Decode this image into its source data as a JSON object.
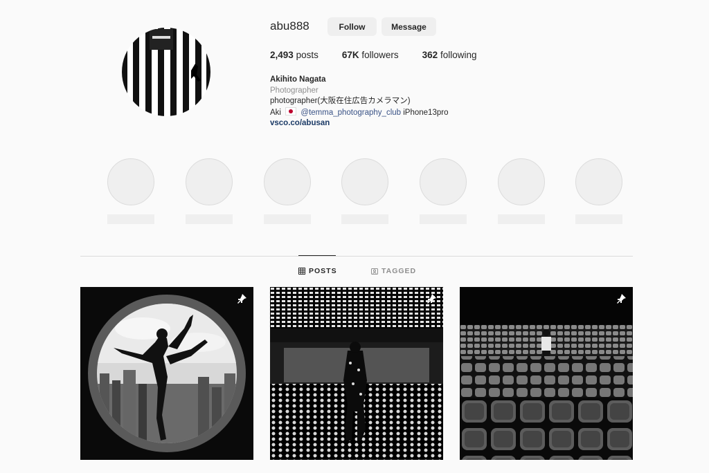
{
  "profile": {
    "username": "abu888",
    "follow_label": "Follow",
    "message_label": "Message",
    "stats": {
      "posts_count": "2,493",
      "posts_label": "posts",
      "followers_count": "67K",
      "followers_label": "followers",
      "following_count": "362",
      "following_label": "following"
    },
    "bio": {
      "name": "Akihito Nagata",
      "category": "Photographer",
      "line1": "photographer(大阪在住広告カメラマン)",
      "line2_prefix": "Aki",
      "line2_mention": "@temma_photography_club",
      "line2_suffix": "iPhone13pro",
      "website": "vsco.co/abusan"
    }
  },
  "tabs": {
    "posts_label": "POSTS",
    "tagged_label": "TAGGED"
  },
  "icons": {
    "grid": "grid-icon",
    "tag": "tag-icon",
    "pin": "pin-icon",
    "flag": "japan-flag-icon"
  },
  "colors": {
    "background": "#fafafa",
    "button_bg": "#efefef",
    "link_dark": "#1b3a66",
    "mention": "#385185",
    "muted": "#8e8e8e"
  }
}
